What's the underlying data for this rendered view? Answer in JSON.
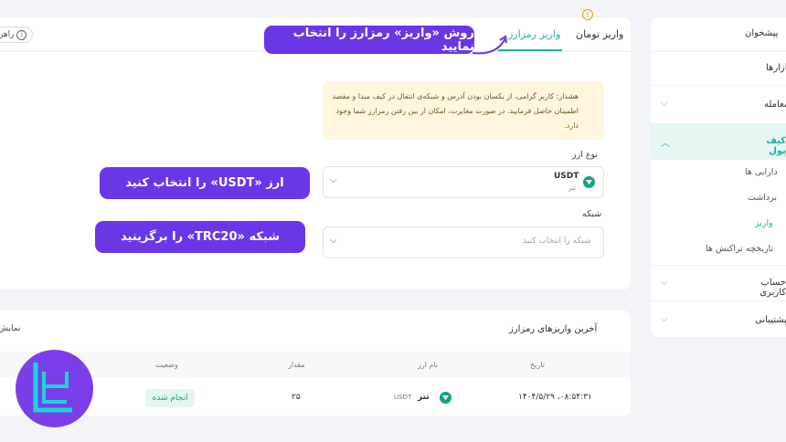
{
  "tabs": {
    "toman_deposit": "واریز تومان",
    "crypto_deposit": "واریز رمزارز"
  },
  "help": {
    "label": "راهن"
  },
  "warning": {
    "text": "هشدار: کاربر گرامی، از یکسان بودن آدرس و شبکه‌ی انتقال در کیف مبدا و مقصد اطمینان حاصل فرمایید. در صورت مغایرت، امکان از بین رفتن رمزارز شما وجود دارد."
  },
  "currency": {
    "label": "نوع ارز",
    "selected_symbol": "USDT",
    "selected_name": "تتر"
  },
  "network": {
    "label": "شبکه",
    "placeholder": "شبکه را انتخاب کنید"
  },
  "callouts": {
    "method": "روش «واریز» رمزارز را انتخاب نمایید",
    "currency": "ارز «USDT» را انتخاب کنید",
    "network": "شبکه «TRC20» را برگزینید"
  },
  "recent": {
    "title": "آخرین واریزهای رمزارز",
    "show_all": "نمایش",
    "columns": {
      "date": "تاریخ",
      "currency": "نام ارز",
      "amount": "مقدار",
      "status": "وضعیت"
    },
    "rows": [
      {
        "date": "۱۴۰۴/۵/۲۹ ،۰۸:۵۴:۳۱",
        "currency_symbol": "USDT",
        "currency_name": "تتر",
        "amount": "۲۵",
        "status": "انجام شده"
      }
    ]
  },
  "sidebar": {
    "items": [
      "پیشخوان",
      "بازارها",
      "معامله",
      "کیف پول",
      "حساب کاربری",
      "پشتیبانی"
    ],
    "wallet_sub": [
      "دارایی ها",
      "برداشت",
      "واریز",
      "تاریخچه تراکنش ها"
    ]
  },
  "colors": {
    "accent": "#1bb3a0",
    "callout": "#6a37e6",
    "warning_bg": "#fff6dd"
  }
}
